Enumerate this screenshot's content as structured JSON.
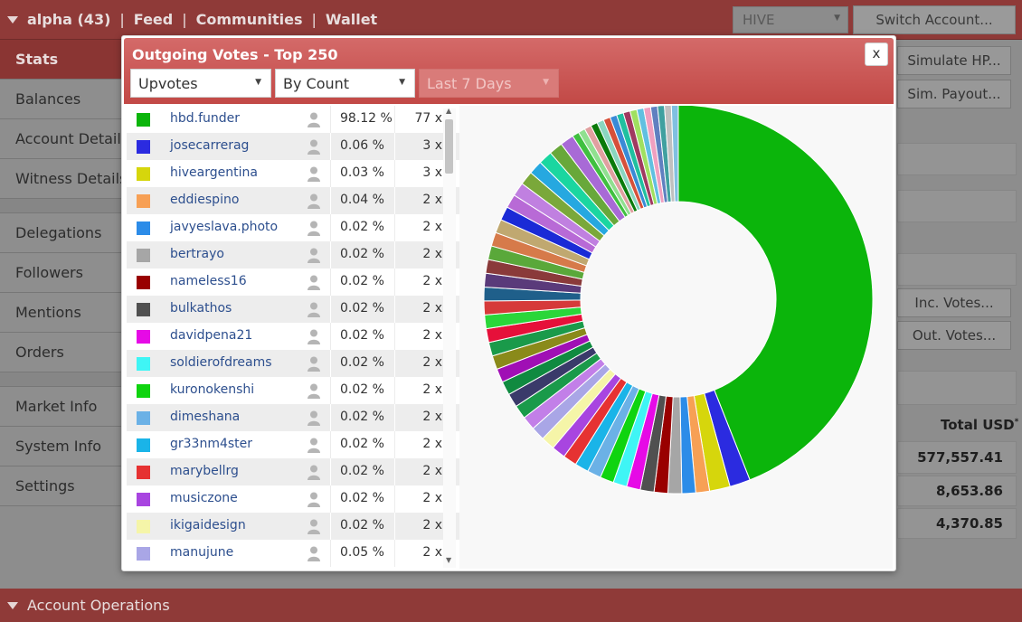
{
  "topbar": {
    "account": "alpha (43)",
    "sep": "|",
    "links": [
      "Feed",
      "Communities",
      "Wallet"
    ],
    "chain_select": "HIVE",
    "switch_label": "Switch Account..."
  },
  "sidebar": {
    "items": [
      "Stats",
      "Balances",
      "Account Details",
      "Witness Details",
      "Delegations",
      "Followers",
      "Mentions",
      "Orders",
      "Market Info",
      "System Info",
      "Settings"
    ]
  },
  "right": {
    "simulate_hp": "Simulate HP...",
    "sim_payout": "Sim. Payout...",
    "inc_votes": "Inc. Votes...",
    "out_votes": "Out. Votes...",
    "total_usd_label": "Total USD",
    "total_usd_star": "*",
    "totals": [
      "577,557.41",
      "8,653.86",
      "4,370.85"
    ]
  },
  "bottom": {
    "label": "Account Operations"
  },
  "modal": {
    "title": "Outgoing Votes - Top 250",
    "close": "x",
    "vote_type": "Upvotes",
    "sort": "By Count",
    "period": "Last 7 Days",
    "rows": [
      {
        "name": "hbd.funder",
        "pct": "98.12 %",
        "count": "77 x",
        "color": "#0bb50b"
      },
      {
        "name": "josecarrerag",
        "pct": "0.06 %",
        "count": "3 x",
        "color": "#2b2be0"
      },
      {
        "name": "hiveargentina",
        "pct": "0.03 %",
        "count": "3 x",
        "color": "#d6d60c"
      },
      {
        "name": "eddiespino",
        "pct": "0.04 %",
        "count": "2 x",
        "color": "#f7a055"
      },
      {
        "name": "javyeslava.photo",
        "pct": "0.02 %",
        "count": "2 x",
        "color": "#2c8ce8"
      },
      {
        "name": "bertrayo",
        "pct": "0.02 %",
        "count": "2 x",
        "color": "#a6a6a6"
      },
      {
        "name": "nameless16",
        "pct": "0.02 %",
        "count": "2 x",
        "color": "#990000"
      },
      {
        "name": "bulkathos",
        "pct": "0.02 %",
        "count": "2 x",
        "color": "#505050"
      },
      {
        "name": "davidpena21",
        "pct": "0.02 %",
        "count": "2 x",
        "color": "#e60ae6"
      },
      {
        "name": "soldierofdreams",
        "pct": "0.02 %",
        "count": "2 x",
        "color": "#3ff5f5"
      },
      {
        "name": "kuronokenshi",
        "pct": "0.02 %",
        "count": "2 x",
        "color": "#0fd40f"
      },
      {
        "name": "dimeshana",
        "pct": "0.02 %",
        "count": "2 x",
        "color": "#6bb1e6"
      },
      {
        "name": "gr33nm4ster",
        "pct": "0.02 %",
        "count": "2 x",
        "color": "#1ab4e8"
      },
      {
        "name": "marybellrg",
        "pct": "0.02 %",
        "count": "2 x",
        "color": "#e63232"
      },
      {
        "name": "musiczone",
        "pct": "0.02 %",
        "count": "2 x",
        "color": "#a845e0"
      },
      {
        "name": "ikigaidesign",
        "pct": "0.02 %",
        "count": "2 x",
        "color": "#f5f5a8"
      },
      {
        "name": "manujune",
        "pct": "0.05 %",
        "count": "2 x",
        "color": "#a9a6e6"
      }
    ]
  },
  "chart_data": {
    "type": "pie",
    "donut": true,
    "legend": "left list",
    "values": [
      77,
      3,
      3,
      2,
      2,
      2,
      2,
      2,
      2,
      2,
      2,
      2,
      2,
      2,
      2,
      2,
      2,
      2,
      2,
      2,
      2,
      2,
      2,
      2,
      2,
      2,
      2,
      2,
      2,
      2,
      2,
      2,
      2,
      2,
      2,
      2,
      2,
      2,
      2,
      2,
      2,
      1,
      1,
      1,
      1,
      1,
      1,
      1,
      1,
      1,
      1,
      1,
      1,
      1,
      1,
      1,
      1
    ],
    "colors": [
      "#0bb50b",
      "#2b2be0",
      "#d6d60c",
      "#f7a055",
      "#2c8ce8",
      "#a6a6a6",
      "#990000",
      "#505050",
      "#e60ae6",
      "#3ff5f5",
      "#0fd40f",
      "#6bb1e6",
      "#1ab4e8",
      "#e63232",
      "#a845e0",
      "#f5f5a8",
      "#a9a6e6",
      "#c27fe8",
      "#1a9a4a",
      "#3a3a6a",
      "#108a40",
      "#a00fb5",
      "#8a8a1a",
      "#1a9a4a",
      "#e6103a",
      "#2ad63a",
      "#d63a3a",
      "#1f5f8a",
      "#5a3a7a",
      "#8a3a3a",
      "#5aa83a",
      "#d67a4a",
      "#c0a870",
      "#1a2ad6",
      "#b86ad6",
      "#c080e0",
      "#7aa83a",
      "#26a8e0",
      "#1ad6a0",
      "#68a83a",
      "#a86ad6",
      "#40c040",
      "#90e090",
      "#e0a0a0",
      "#0a7a0a",
      "#8ad6c0",
      "#d6503a",
      "#3a8ad6",
      "#20c0a0",
      "#a03a60",
      "#a0e060",
      "#60c0e0",
      "#f0a0c0",
      "#6080c0",
      "#40a0a0",
      "#c0c0c0",
      "#80c0e0"
    ]
  }
}
